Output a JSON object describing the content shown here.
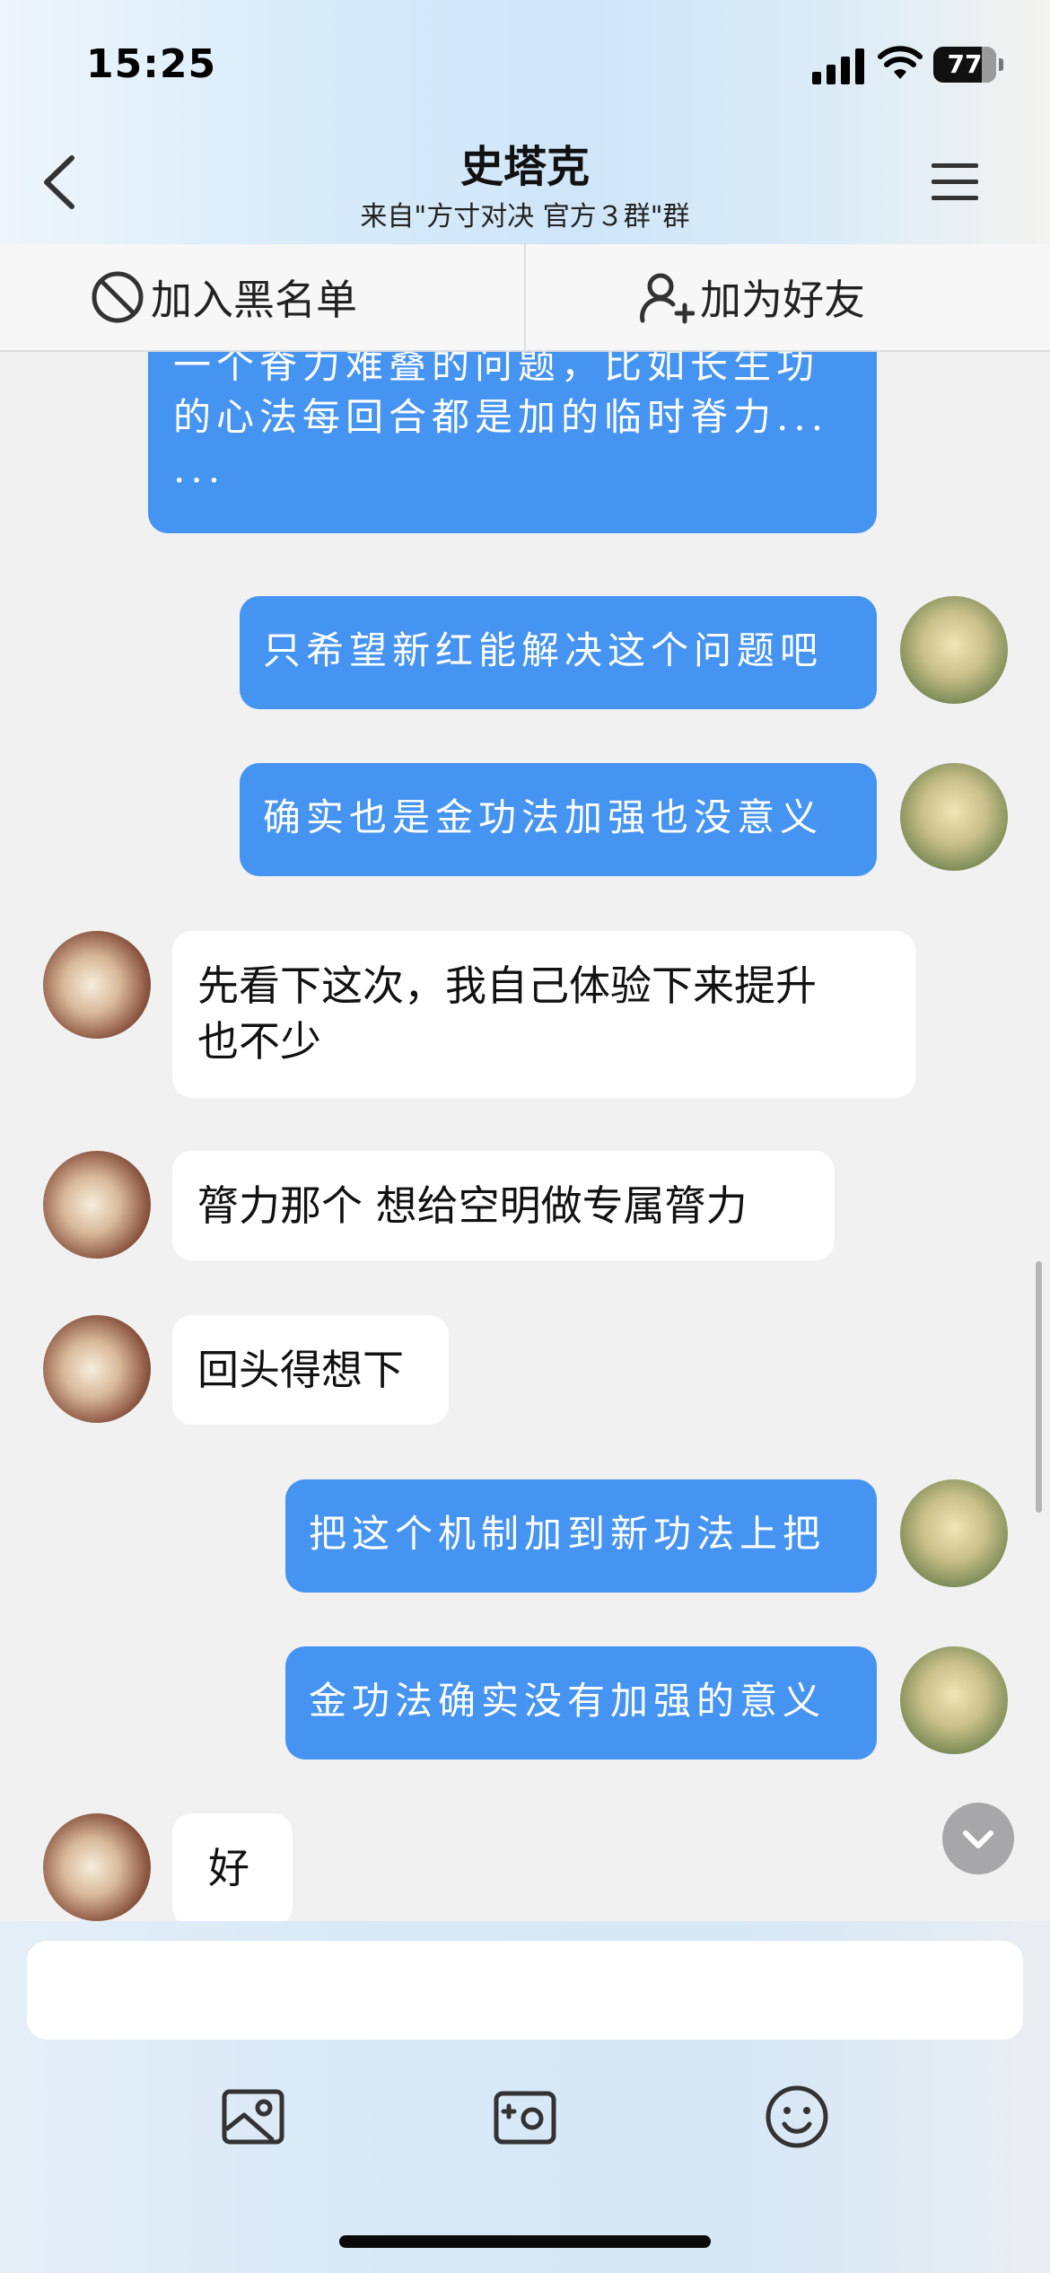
{
  "status_bar": {
    "time": "15:25",
    "battery": "77"
  },
  "header": {
    "title": "史塔克",
    "subtitle": "来自\"方寸对决 官方３群\"群"
  },
  "actions": {
    "blacklist_label": "加入黑名单",
    "add_friend_label": "加为好友"
  },
  "messages": [
    {
      "sender": "me",
      "lines": [
        "一个脊力难叠的问题，比如长生功",
        "的心法每回合都是加的临时脊力...",
        "..."
      ]
    },
    {
      "sender": "me",
      "lines": [
        "只希望新红能解决这个问题吧"
      ]
    },
    {
      "sender": "me",
      "lines": [
        "确实也是金功法加强也没意义"
      ]
    },
    {
      "sender": "other",
      "lines": [
        "先看下这次，我自己体验下来提升",
        "也不少"
      ]
    },
    {
      "sender": "other",
      "lines": [
        "膂力那个 想给空明做专属膂力"
      ]
    },
    {
      "sender": "other",
      "lines": [
        "回头得想下"
      ]
    },
    {
      "sender": "me",
      "lines": [
        "把这个机制加到新功法上把"
      ]
    },
    {
      "sender": "me",
      "lines": [
        "金功法确实没有加强的意义"
      ]
    },
    {
      "sender": "other",
      "lines": [
        "好"
      ]
    }
  ],
  "input": {
    "placeholder": ""
  },
  "icons": {
    "back": "chevron-left-icon",
    "menu": "hamburger-menu-icon",
    "blacklist": "block-icon",
    "add_friend": "add-user-icon",
    "photo": "photo-icon",
    "camera": "camera-icon",
    "emoji": "emoji-icon",
    "scroll_down": "chevron-down-icon"
  },
  "colors": {
    "my_bubble": "#4694f2",
    "their_bubble": "#ffffff",
    "background": "#f1f1f2"
  }
}
